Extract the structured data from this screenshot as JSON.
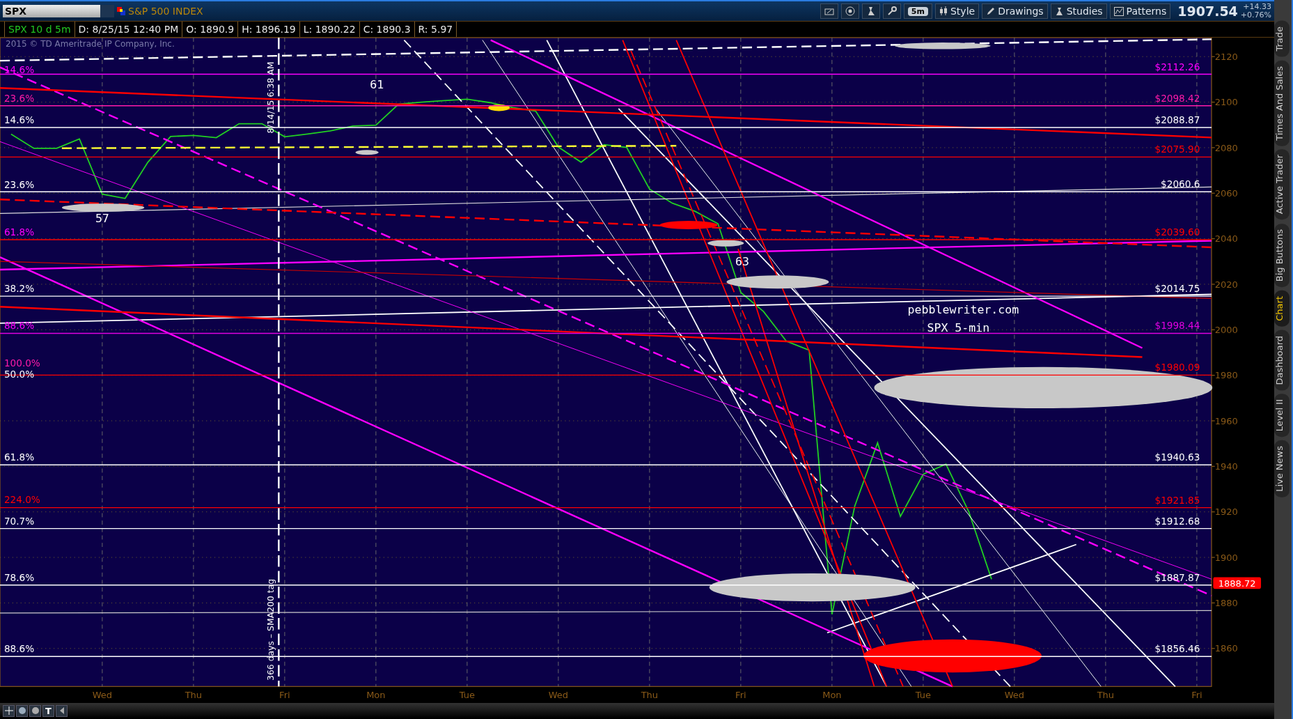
{
  "toolbar": {
    "symbol": "SPX",
    "description": "S&P 500 INDEX",
    "interval": "5m",
    "buttons": [
      {
        "label": "Style",
        "kind": "style"
      },
      {
        "label": "Drawings",
        "kind": "drawings"
      },
      {
        "label": "Studies",
        "kind": "studies"
      },
      {
        "label": "Patterns",
        "kind": "patterns"
      }
    ],
    "last": "1907.54",
    "change": "+14.33",
    "change_pct": "+0.76%"
  },
  "info_bar": [
    "SPX 10 d 5m",
    "D: 8/25/15 12:40 PM",
    "O: 1890.9",
    "H: 1896.19",
    "L: 1890.22",
    "C: 1890.3",
    "R: 5.97"
  ],
  "chart": {
    "copyright": "2015 © TD Ameritrade IP Company, Inc.",
    "levels": [
      {
        "label": "$2112.26",
        "color": "#ff00ff"
      },
      {
        "label": "$2098.42",
        "color": "#ff1aa8"
      },
      {
        "label": "$2088.87",
        "color": "#ffffff"
      },
      {
        "label": "$2075.90",
        "color": "#ff0000"
      },
      {
        "label": "$2060.6",
        "color": "#ffffff"
      },
      {
        "label": "$2039.60",
        "color": "#ff0000"
      },
      {
        "label": "$2014.75",
        "color": "#ffffff"
      },
      {
        "label": "$1998.44",
        "color": "#e000e0"
      },
      {
        "label": "$1980.09",
        "color": "#ff0000"
      },
      {
        "label": "$1940.63",
        "color": "#ffffff"
      },
      {
        "label": "$1921.85",
        "color": "#ff0000"
      },
      {
        "label": "$1912.68",
        "color": "#ffffff"
      },
      {
        "label": "$1887.87",
        "color": "#ffffff"
      },
      {
        "label": "$1856.46",
        "color": "#ffffff"
      }
    ],
    "fib_labels": [
      {
        "label": "14.6%",
        "color": "#ff00ff"
      },
      {
        "label": "23.6%",
        "color": "#ff1aa8"
      },
      {
        "label": "14.6%",
        "color": "#ffffff"
      },
      {
        "label": "23.6%",
        "color": "#ffffff"
      },
      {
        "label": "61.8%",
        "color": "#ff00ff"
      },
      {
        "label": "38.2%",
        "color": "#ffffff"
      },
      {
        "label": "88.6%",
        "color": "#ff00ff"
      },
      {
        "label": "100.0%",
        "color": "#ff1aa8"
      },
      {
        "label": "50.0%",
        "color": "#ffffff"
      },
      {
        "label": "61.8%",
        "color": "#ffffff"
      },
      {
        "label": "224.0%",
        "color": "#ff0000"
      },
      {
        "label": "70.7%",
        "color": "#ffffff"
      },
      {
        "label": "78.6%",
        "color": "#ffffff"
      },
      {
        "label": "88.6%",
        "color": "#ffffff"
      }
    ],
    "notes": [
      "57",
      "61",
      "63",
      "pebblewriter.com",
      "SPX 5-min"
    ],
    "vertical_labels": [
      "8/14/15 6:38 AM",
      "366 days – SMA200 tag"
    ],
    "current_price": "1888.72",
    "chart_data": {
      "type": "line",
      "grid": true,
      "ylim": [
        1843.3,
        2128.34
      ],
      "categories": [
        null,
        null,
        null,
        null,
        "Wed",
        null,
        null,
        null,
        "Thu",
        null,
        null,
        null,
        "Fri",
        null,
        null,
        null,
        "Mon",
        null,
        null,
        null,
        "Tue",
        null,
        null,
        null,
        "Wed",
        null,
        null,
        null,
        "Thu",
        null,
        null,
        null,
        "Fri",
        null,
        null,
        null,
        "Mon",
        null,
        null,
        null,
        "Tue",
        null,
        null,
        null,
        "Wed",
        null,
        null,
        null,
        "Thu",
        null,
        null,
        null,
        "Fri"
      ],
      "yticks": [
        1860,
        1880,
        1900,
        1920,
        1940,
        1960,
        1980,
        2000,
        2020,
        2040,
        2060,
        2080,
        2100,
        2120
      ],
      "series": [
        {
          "color": "#22d122",
          "values": [
            2086,
            2079.7,
            2079.7,
            2083.8,
            2059.6,
            2057.7,
            2073.6,
            2084.9,
            2085.4,
            2084.4,
            2090.5,
            2090.5,
            2084.8,
            2086,
            2087.4,
            2089.5,
            2089.9,
            2099.2,
            2100,
            2100.7,
            2101.3,
            2099.8,
            2097.6,
            2096.1,
            2080.3,
            2073.6,
            2081.3,
            2080.1,
            2061.8,
            2055.6,
            2052,
            2046.6,
            2016.4,
            2008,
            1995,
            1991,
            1875,
            1922.5,
            1950.3,
            1918,
            1936.5,
            1941,
            1920,
            1890.4,
            null,
            null,
            null,
            null,
            null,
            null,
            null,
            null,
            null
          ]
        }
      ]
    }
  },
  "bottom_tools": {
    "text_tool": "T"
  },
  "side_tabs": [
    {
      "label": "Trade",
      "selected": false
    },
    {
      "label": "Times And Sales",
      "selected": false
    },
    {
      "label": "Active Trader",
      "selected": false
    },
    {
      "label": "Big Buttons",
      "selected": false
    },
    {
      "label": "Chart",
      "selected": true
    },
    {
      "label": "Dashboard",
      "selected": false
    },
    {
      "label": "Level II",
      "selected": false
    },
    {
      "label": "Live News",
      "selected": false
    }
  ]
}
